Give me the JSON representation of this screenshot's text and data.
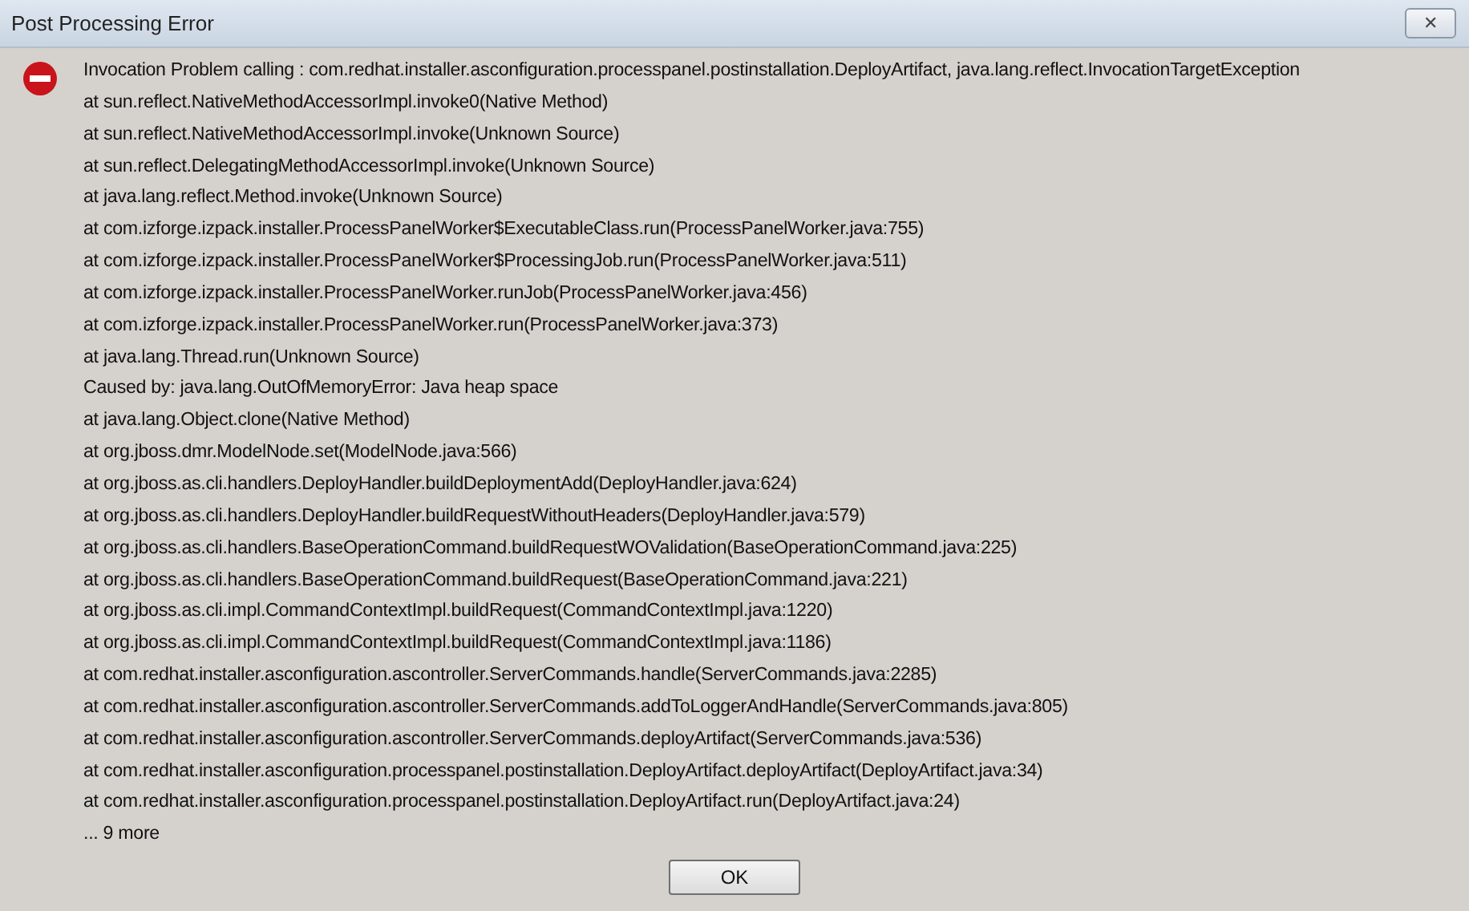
{
  "window": {
    "title": "Post Processing Error",
    "close_label": "✕"
  },
  "message_lines": [
    "Invocation Problem calling : com.redhat.installer.asconfiguration.processpanel.postinstallation.DeployArtifact, java.lang.reflect.InvocationTargetException",
    "at sun.reflect.NativeMethodAccessorImpl.invoke0(Native Method)",
    "at sun.reflect.NativeMethodAccessorImpl.invoke(Unknown Source)",
    "at sun.reflect.DelegatingMethodAccessorImpl.invoke(Unknown Source)",
    "at java.lang.reflect.Method.invoke(Unknown Source)",
    "at com.izforge.izpack.installer.ProcessPanelWorker$ExecutableClass.run(ProcessPanelWorker.java:755)",
    "at com.izforge.izpack.installer.ProcessPanelWorker$ProcessingJob.run(ProcessPanelWorker.java:511)",
    "at com.izforge.izpack.installer.ProcessPanelWorker.runJob(ProcessPanelWorker.java:456)",
    "at com.izforge.izpack.installer.ProcessPanelWorker.run(ProcessPanelWorker.java:373)",
    "at java.lang.Thread.run(Unknown Source)",
    "Caused by: java.lang.OutOfMemoryError: Java heap space",
    "at java.lang.Object.clone(Native Method)",
    "at org.jboss.dmr.ModelNode.set(ModelNode.java:566)",
    "at org.jboss.as.cli.handlers.DeployHandler.buildDeploymentAdd(DeployHandler.java:624)",
    "at org.jboss.as.cli.handlers.DeployHandler.buildRequestWithoutHeaders(DeployHandler.java:579)",
    "at org.jboss.as.cli.handlers.BaseOperationCommand.buildRequestWOValidation(BaseOperationCommand.java:225)",
    "at org.jboss.as.cli.handlers.BaseOperationCommand.buildRequest(BaseOperationCommand.java:221)",
    "at org.jboss.as.cli.impl.CommandContextImpl.buildRequest(CommandContextImpl.java:1220)",
    "at org.jboss.as.cli.impl.CommandContextImpl.buildRequest(CommandContextImpl.java:1186)",
    "at com.redhat.installer.asconfiguration.ascontroller.ServerCommands.handle(ServerCommands.java:2285)",
    "at com.redhat.installer.asconfiguration.ascontroller.ServerCommands.addToLoggerAndHandle(ServerCommands.java:805)",
    "at com.redhat.installer.asconfiguration.ascontroller.ServerCommands.deployArtifact(ServerCommands.java:536)",
    "at com.redhat.installer.asconfiguration.processpanel.postinstallation.DeployArtifact.deployArtifact(DeployArtifact.java:34)",
    "at com.redhat.installer.asconfiguration.processpanel.postinstallation.DeployArtifact.run(DeployArtifact.java:24)",
    "... 9 more"
  ],
  "buttons": [
    "OK"
  ]
}
